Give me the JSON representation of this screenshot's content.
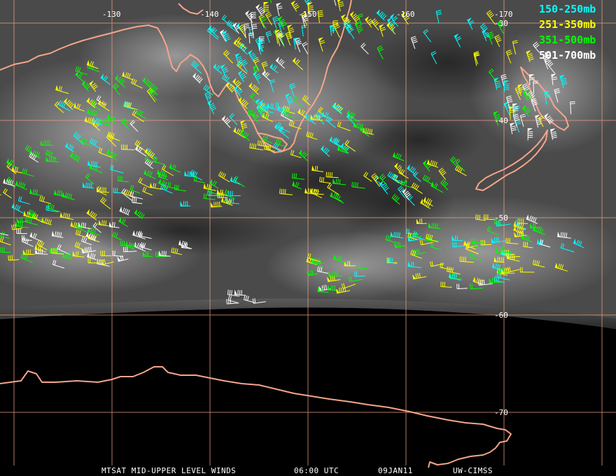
{
  "product": {
    "satellite_label": "MTSAT MID-UPPER LEVEL WINDS",
    "time_label": "06:00 UTC",
    "date_label": "09JAN11",
    "credit_label": "UW-CIMSS"
  },
  "legend": {
    "items": [
      {
        "label": "150-250mb",
        "color": "#00ffff"
      },
      {
        "label": "251-350mb",
        "color": "#ffff00"
      },
      {
        "label": "351-500mb",
        "color": "#00ff00"
      },
      {
        "label": "501-700mb",
        "color": "#ffffff"
      }
    ]
  },
  "grid": {
    "longitude_labels": [
      "-130",
      "-140",
      "-150",
      "-160",
      "-170"
    ],
    "latitude_labels": [
      "-30",
      "-40",
      "-50",
      "-60",
      "-70"
    ],
    "line_color": "#f0a080"
  },
  "colors": {
    "coastline": "#f5a58a",
    "imagery_dark": "#3a3a3a",
    "imagery_light": "#9a9a9a",
    "space": "#000000"
  }
}
